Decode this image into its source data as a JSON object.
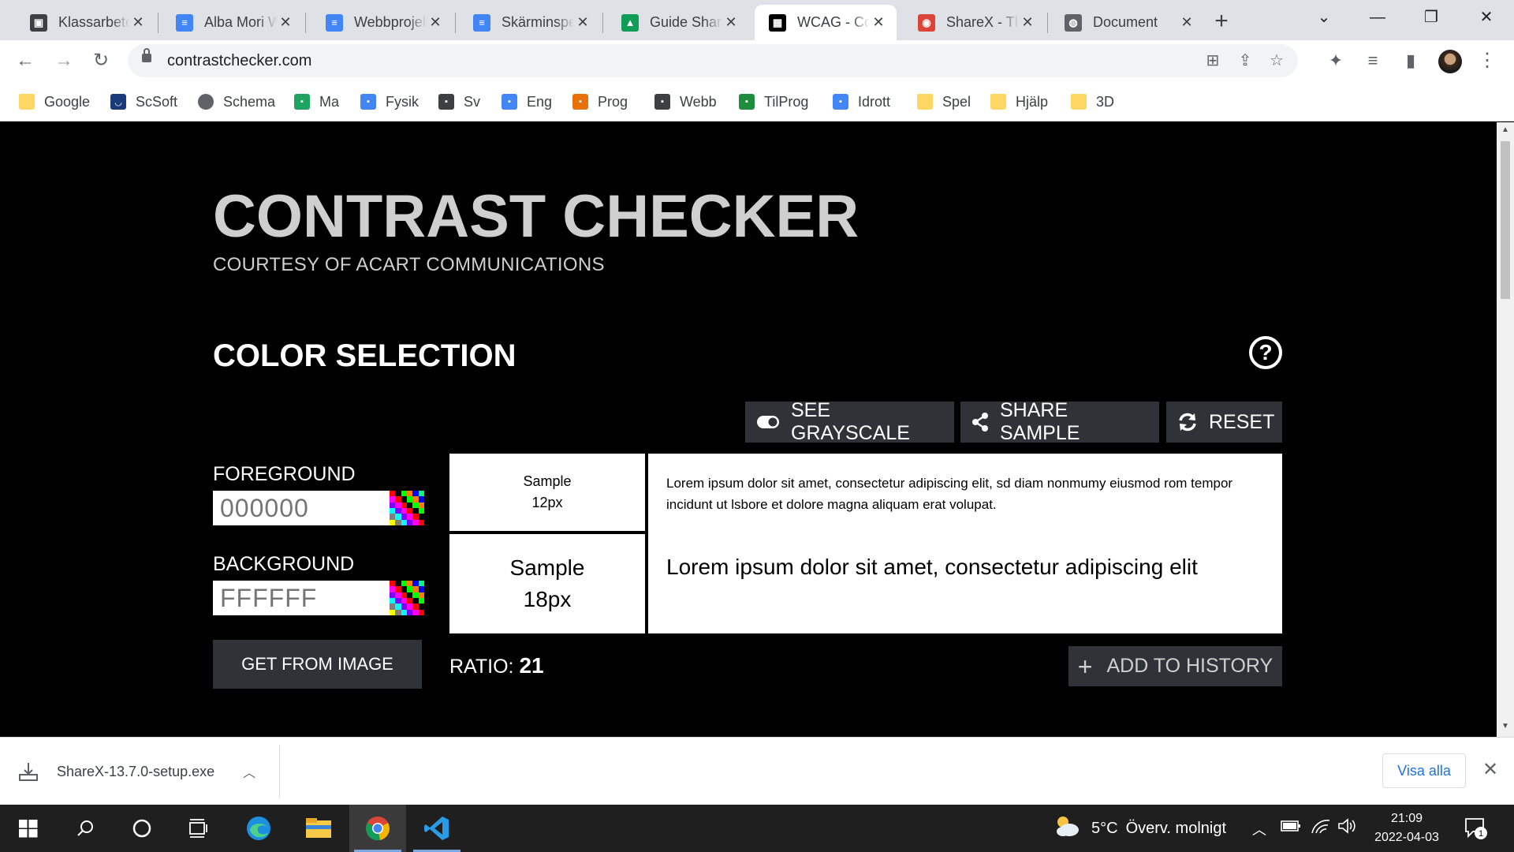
{
  "browser": {
    "tabs": [
      {
        "title": "Klassarbete",
        "icon": "classroom-icon",
        "color": "#3c4043"
      },
      {
        "title": "Alba Mori W",
        "icon": "docs-icon",
        "color": "#4285f4"
      },
      {
        "title": "Webbprojekt",
        "icon": "docs-icon",
        "color": "#4285f4"
      },
      {
        "title": "Skärminspelning",
        "icon": "docs-icon",
        "color": "#4285f4"
      },
      {
        "title": "Guide Share",
        "icon": "drive-icon",
        "color": "#0f9d58"
      },
      {
        "title": "WCAG - Co",
        "icon": "contrast-site-icon",
        "color": "#000000",
        "active": true
      },
      {
        "title": "ShareX - Th",
        "icon": "chrome-icon",
        "color": "#db4437"
      },
      {
        "title": "Document",
        "icon": "globe-icon",
        "color": "#5f6368"
      }
    ],
    "url": "contrastchecker.com",
    "bookmarks": [
      {
        "label": "Google",
        "icon": "folder-icon"
      },
      {
        "label": "ScSoft",
        "icon": "scsoft-icon"
      },
      {
        "label": "Schema",
        "icon": "globe-icon"
      },
      {
        "label": "Ma",
        "icon": "classroom-icon"
      },
      {
        "label": "Fysik",
        "icon": "classroom-icon"
      },
      {
        "label": "Sv",
        "icon": "classroom-icon"
      },
      {
        "label": "Eng",
        "icon": "classroom-icon"
      },
      {
        "label": "Prog",
        "icon": "classroom-icon"
      },
      {
        "label": "Webb",
        "icon": "classroom-icon"
      },
      {
        "label": "TilProg",
        "icon": "classroom-icon"
      },
      {
        "label": "Idrott",
        "icon": "classroom-icon"
      },
      {
        "label": "Spel",
        "icon": "folder-icon"
      },
      {
        "label": "Hjälp",
        "icon": "folder-icon"
      },
      {
        "label": "3D",
        "icon": "folder-icon"
      }
    ]
  },
  "page": {
    "title": "CONTRAST CHECKER",
    "subtitle": "COURTESY OF ACART COMMUNICATIONS",
    "section_title": "COLOR SELECTION",
    "buttons": {
      "grayscale": "SEE GRAYSCALE",
      "share": "SHARE SAMPLE",
      "reset": "RESET",
      "get_from_image": "GET FROM IMAGE",
      "add_history": "ADD TO HISTORY"
    },
    "foreground": {
      "label": "FOREGROUND",
      "placeholder": "000000"
    },
    "background": {
      "label": "BACKGROUND",
      "placeholder": "FFFFFF"
    },
    "samples": {
      "small_label": "Sample",
      "small_size": "12px",
      "large_label": "Sample",
      "large_size": "18px",
      "small_text": "Lorem ipsum dolor sit amet, consectetur adipiscing elit, sd diam nonmumy eiusmod rom tempor incidunt ut lsbore et dolore magna aliquam erat volupat.",
      "large_text": "Lorem ipsum dolor sit amet, consectetur adipiscing elit"
    },
    "ratio_label": "RATIO:",
    "ratio_value": "21"
  },
  "downloads": {
    "file": "ShareX-13.7.0-setup.exe",
    "show_all": "Visa alla"
  },
  "taskbar": {
    "weather_temp": "5°C",
    "weather_text": "Överv. molnigt",
    "time": "21:09",
    "date": "2022-04-03",
    "notifications": "1"
  }
}
